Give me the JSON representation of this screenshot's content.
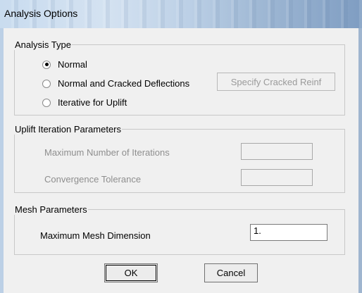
{
  "window": {
    "title": "Analysis Options"
  },
  "analysis_type": {
    "legend": "Analysis Type",
    "options": [
      {
        "label": "Normal",
        "selected": true
      },
      {
        "label": "Normal and Cracked Deflections",
        "selected": false
      },
      {
        "label": "Iterative for Uplift",
        "selected": false
      }
    ],
    "cracked_button_label": "Specify Cracked Reinf"
  },
  "uplift": {
    "legend": "Uplift Iteration Parameters",
    "max_iterations_label": "Maximum Number of Iterations",
    "max_iterations_value": "",
    "convergence_label": "Convergence Tolerance",
    "convergence_value": ""
  },
  "mesh": {
    "legend": "Mesh Parameters",
    "max_dimension_label": "Maximum Mesh Dimension",
    "max_dimension_value": "1."
  },
  "buttons": {
    "ok": "OK",
    "cancel": "Cancel"
  }
}
